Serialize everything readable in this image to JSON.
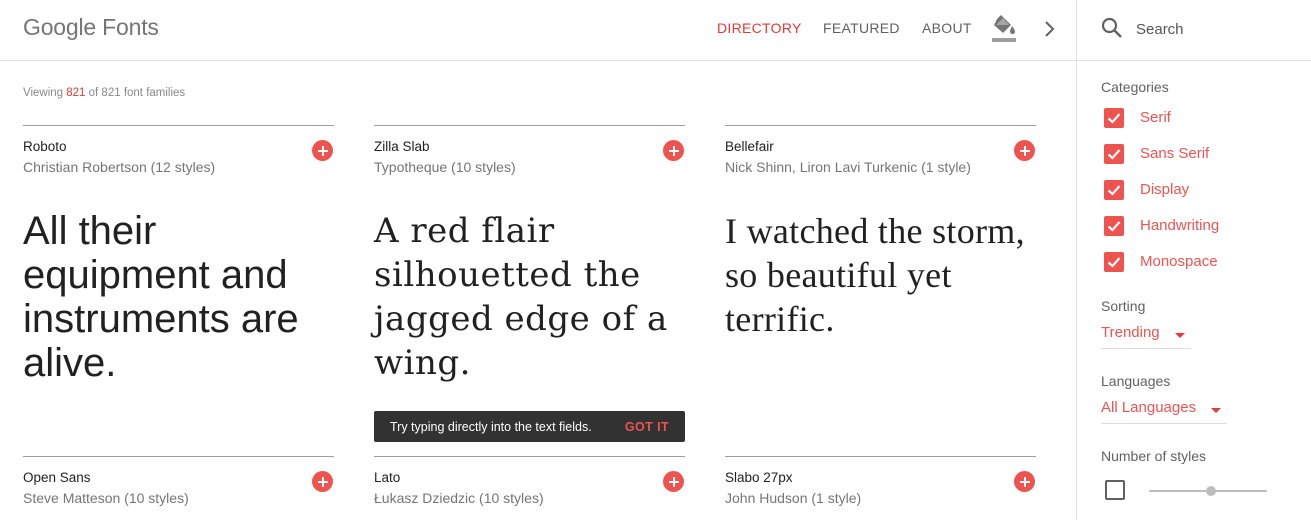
{
  "header": {
    "logo": "Google Fonts",
    "nav": [
      {
        "label": "DIRECTORY",
        "active": true
      },
      {
        "label": "FEATURED",
        "active": false
      },
      {
        "label": "ABOUT",
        "active": false
      }
    ],
    "customize_icon": "format-color-fill-icon",
    "next_icon": "chevron-right-icon"
  },
  "search": {
    "placeholder": "Search",
    "icon": "search-icon"
  },
  "results": {
    "prefix": "Viewing ",
    "shown": "821",
    "suffix": " of 821 font families"
  },
  "cards": [
    {
      "name": "Roboto",
      "meta": "Christian Robertson (12 styles)",
      "sample": "All their equipment and instruments are alive."
    },
    {
      "name": "Zilla Slab",
      "meta": "Typotheque (10 styles)",
      "sample": "A red flair silhouetted the jagged edge of a wing."
    },
    {
      "name": "Bellefair",
      "meta": "Nick Shinn, Liron Lavi Turkenic (1 style)",
      "sample": "I watched the storm, so beautiful yet terrific."
    },
    {
      "name": "Open Sans",
      "meta": "Steve Matteson (10 styles)"
    },
    {
      "name": "Lato",
      "meta": "Łukasz Dziedzic (10 styles)"
    },
    {
      "name": "Slabo 27px",
      "meta": "John Hudson (1 style)"
    }
  ],
  "toast": {
    "message": "Try typing directly into the text fields.",
    "action": "GOT IT"
  },
  "sidebar": {
    "categories_label": "Categories",
    "categories": [
      {
        "label": "Serif",
        "checked": true
      },
      {
        "label": "Sans Serif",
        "checked": true
      },
      {
        "label": "Display",
        "checked": true
      },
      {
        "label": "Handwriting",
        "checked": true
      },
      {
        "label": "Monospace",
        "checked": true
      }
    ],
    "sorting_label": "Sorting",
    "sorting_value": "Trending",
    "languages_label": "Languages",
    "languages_value": "All Languages",
    "styles_label": "Number of styles",
    "styles_checked": false
  },
  "colors": {
    "accent": "#ef5350",
    "text_muted": "#757575"
  }
}
